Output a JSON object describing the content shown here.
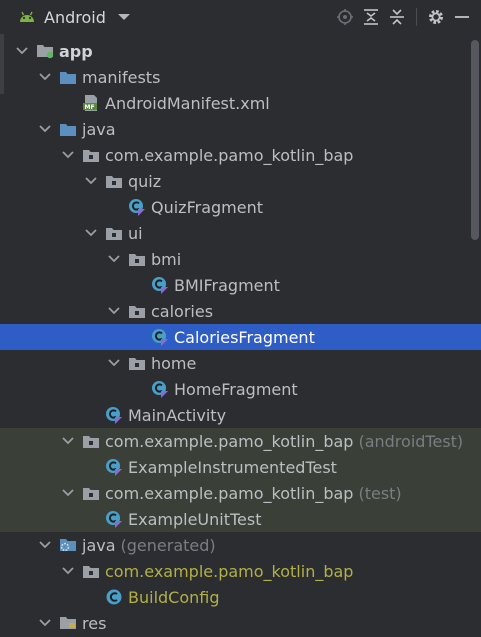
{
  "toolbar": {
    "view_label": "Android",
    "icons": [
      "android-icon",
      "dropdown-icon",
      "locate-icon",
      "expand-all-icon",
      "collapse-all-icon",
      "settings-icon",
      "hide-icon"
    ]
  },
  "colors": {
    "background": "#2b2d30",
    "selection": "#2e5ec5",
    "test_rows": "#3a3f38",
    "generated_text": "#b3b046",
    "folder_blue": "#5b8fbf",
    "kotlin_class": "#48a0c8"
  },
  "tree": {
    "rows": [
      {
        "label": "app",
        "icon": "module-folder-icon",
        "expanded": true,
        "bold": true
      },
      {
        "label": "manifests",
        "icon": "folder-icon",
        "expanded": true
      },
      {
        "label": "AndroidManifest.xml",
        "icon": "manifest-file-icon"
      },
      {
        "label": "java",
        "icon": "folder-icon",
        "expanded": true
      },
      {
        "label": "com.example.pamo_kotlin_bap",
        "icon": "package-icon",
        "expanded": true
      },
      {
        "label": "quiz",
        "icon": "package-icon",
        "expanded": true
      },
      {
        "label": "QuizFragment",
        "icon": "kotlin-class-icon"
      },
      {
        "label": "ui",
        "icon": "package-icon",
        "expanded": true
      },
      {
        "label": "bmi",
        "icon": "package-icon",
        "expanded": true
      },
      {
        "label": "BMIFragment",
        "icon": "kotlin-class-icon"
      },
      {
        "label": "calories",
        "icon": "package-icon",
        "expanded": true
      },
      {
        "label": "CaloriesFragment",
        "icon": "kotlin-class-icon",
        "selected": true
      },
      {
        "label": "home",
        "icon": "package-icon",
        "expanded": true
      },
      {
        "label": "HomeFragment",
        "icon": "kotlin-class-icon"
      },
      {
        "label": "MainActivity",
        "icon": "kotlin-class-icon"
      },
      {
        "label": "com.example.pamo_kotlin_bap",
        "suffix": "(androidTest)",
        "icon": "package-icon",
        "expanded": true,
        "test": true
      },
      {
        "label": "ExampleInstrumentedTest",
        "icon": "kotlin-class-icon",
        "test": true
      },
      {
        "label": "com.example.pamo_kotlin_bap",
        "suffix": "(test)",
        "icon": "package-icon",
        "expanded": true,
        "test": true
      },
      {
        "label": "ExampleUnitTest",
        "icon": "kotlin-class-icon",
        "test": true
      },
      {
        "label": "java",
        "suffix": "(generated)",
        "icon": "generated-folder-icon",
        "expanded": true
      },
      {
        "label": "com.example.pamo_kotlin_bap",
        "icon": "package-icon",
        "expanded": true,
        "generated": true
      },
      {
        "label": "BuildConfig",
        "icon": "java-class-icon",
        "generated": true
      },
      {
        "label": "res",
        "icon": "res-folder-icon",
        "expanded": true
      }
    ]
  }
}
